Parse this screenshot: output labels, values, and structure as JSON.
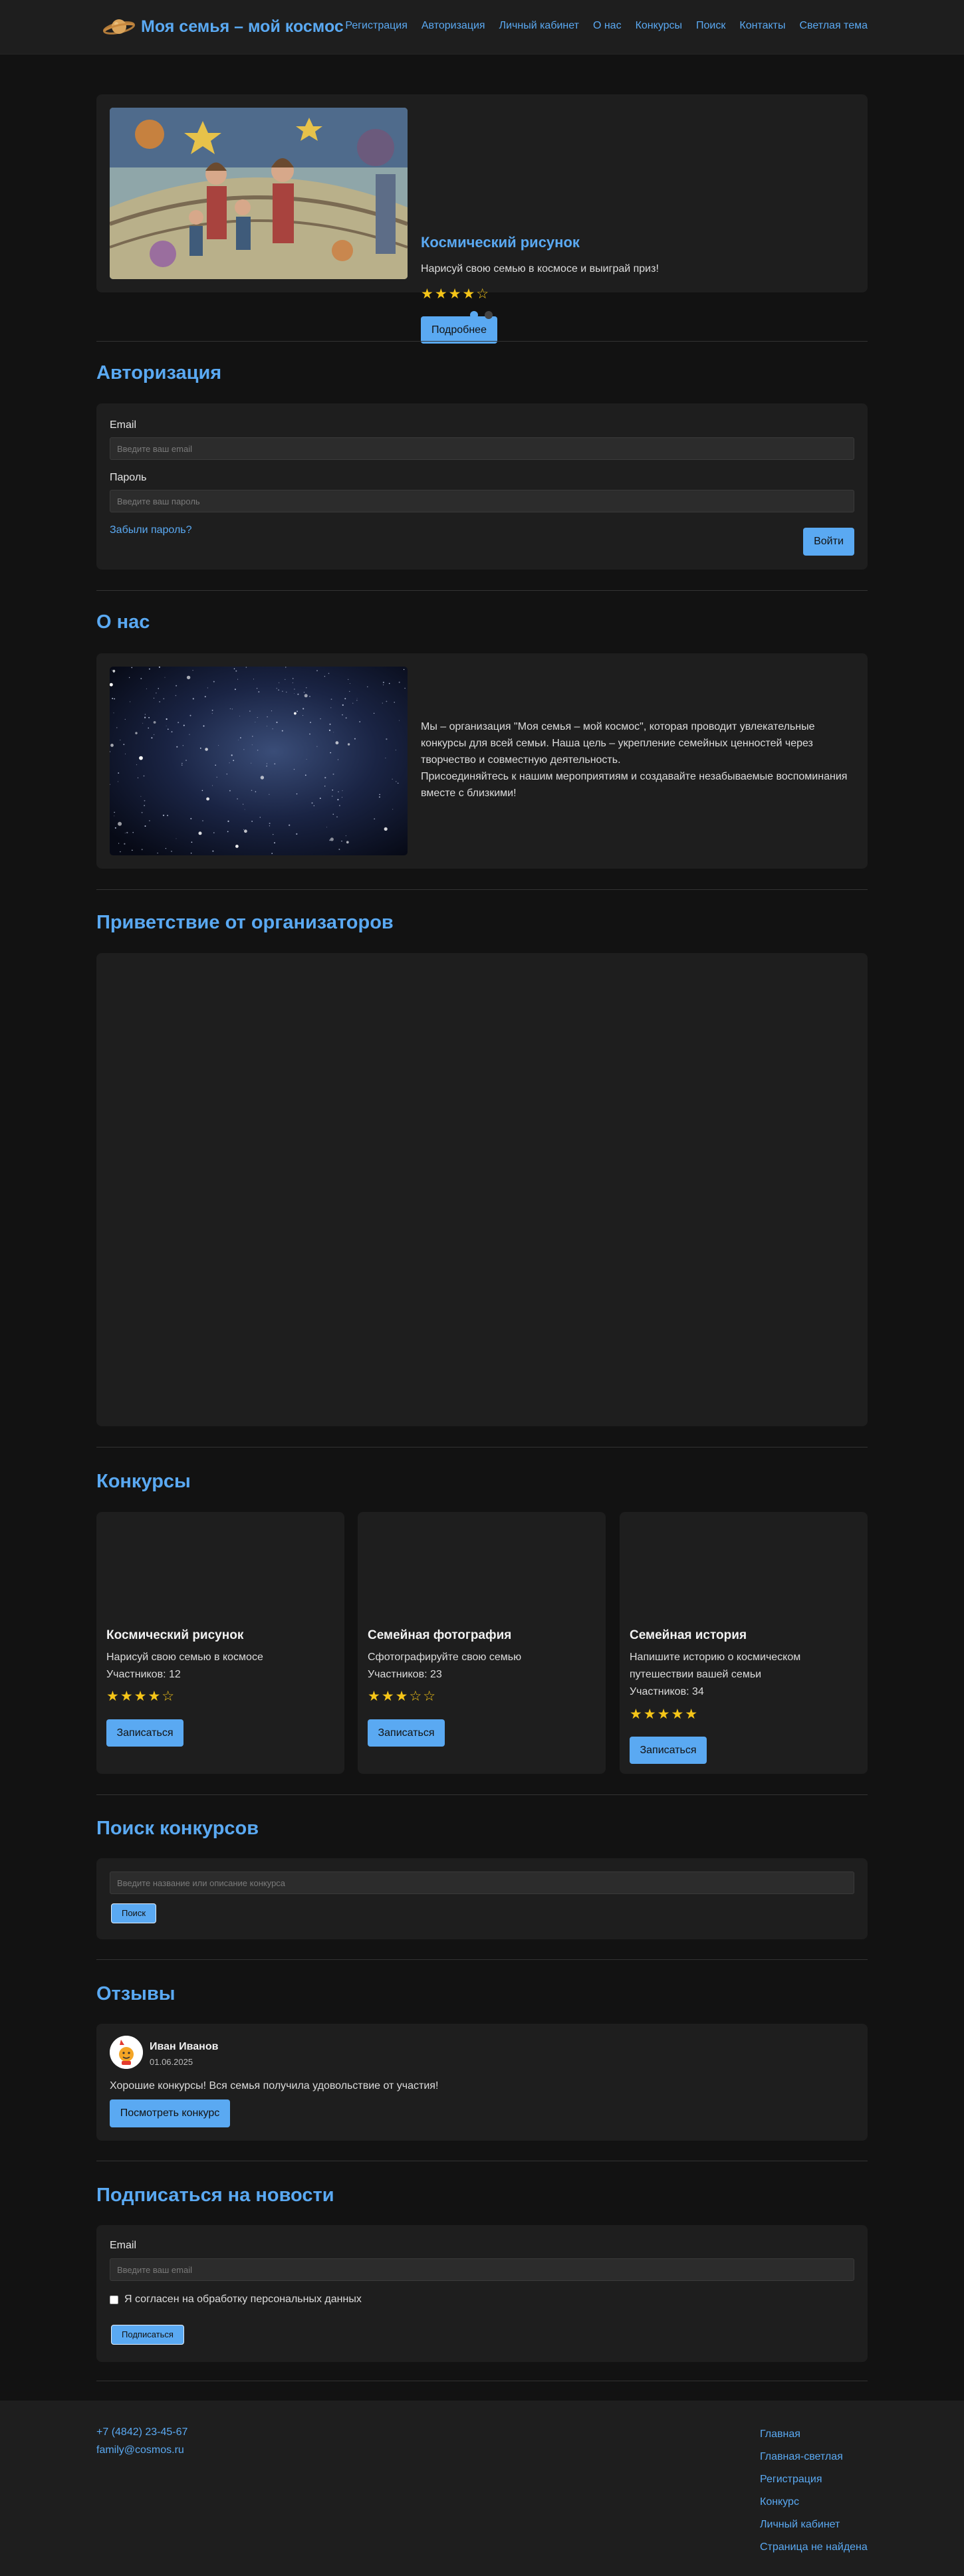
{
  "header": {
    "logo_text": "Моя семья – мой космос",
    "nav": [
      "Регистрация",
      "Авторизация",
      "Личный кабинет",
      "О нас",
      "Конкурсы",
      "Поиск",
      "Контакты",
      "Светлая тема"
    ]
  },
  "slider": {
    "title": "Космический рисунок",
    "description": "Нарисуй свою семью в космосе и выиграй приз!",
    "stars": "★★★★☆",
    "button": "Подробнее",
    "slide_count": 2,
    "active_slide": 1
  },
  "auth": {
    "title": "Авторизация",
    "email_label": "Email",
    "email_placeholder": "Введите ваш email",
    "password_label": "Пароль",
    "password_placeholder": "Введите ваш пароль",
    "forgot": "Забыли пароль?",
    "submit": "Войти"
  },
  "about": {
    "title": "О нас",
    "text_1": "Мы – организация \"Моя семья – мой космос\", которая проводит увлекательные конкурсы для всей семьи. Наша цель – укрепление семейных ценностей через творчество и совместную деятельность.",
    "text_2": "Присоединяйтесь к нашим мероприятиям и создавайте незабываемые воспоминания вместе с близкими!"
  },
  "welcome": {
    "title": "Приветствие от организаторов"
  },
  "contests": {
    "title": "Конкурсы",
    "items": [
      {
        "title": "Космический рисунок",
        "description": "Нарисуй свою семью в космосе",
        "participants": "Участников: 12",
        "stars": "★★★★☆",
        "button": "Записаться"
      },
      {
        "title": "Семейная фотография",
        "description": "Сфотографируйте свою семью",
        "participants": "Участников: 23",
        "stars": "★★★☆☆",
        "button": "Записаться"
      },
      {
        "title": "Семейная история",
        "description": "Напишите историю о космическом путешествии вашей семьи",
        "participants": "Участников: 34",
        "stars": "★★★★★",
        "button": "Записаться"
      }
    ]
  },
  "search": {
    "title": "Поиск конкурсов",
    "placeholder": "Введите название или описание конкурса",
    "button": "Поиск"
  },
  "reviews": {
    "title": "Отзывы",
    "items": [
      {
        "name": "Иван Иванов",
        "date": "01.06.2025",
        "text": "Хорошие конкурсы! Вся семья получила удовольствие от участия!",
        "button": "Посмотреть конкурс"
      }
    ]
  },
  "newsletter": {
    "title": "Подписаться на новости",
    "email_label": "Email",
    "email_placeholder": "Введите ваш email",
    "consent": "Я согласен на обработку персональных данных",
    "button": "Подписаться"
  },
  "footer": {
    "phone": "+7 (4842) 23-45-67",
    "email": "family@cosmos.ru",
    "links": [
      "Главная",
      "Главная-светлая",
      "Регистрация",
      "Конкурс",
      "Личный кабинет",
      "Страница не найдена"
    ]
  },
  "colors": {
    "background": "#121212",
    "surface": "#1e1e1e",
    "accent": "#5aa9f2",
    "star": "#f5c518"
  }
}
